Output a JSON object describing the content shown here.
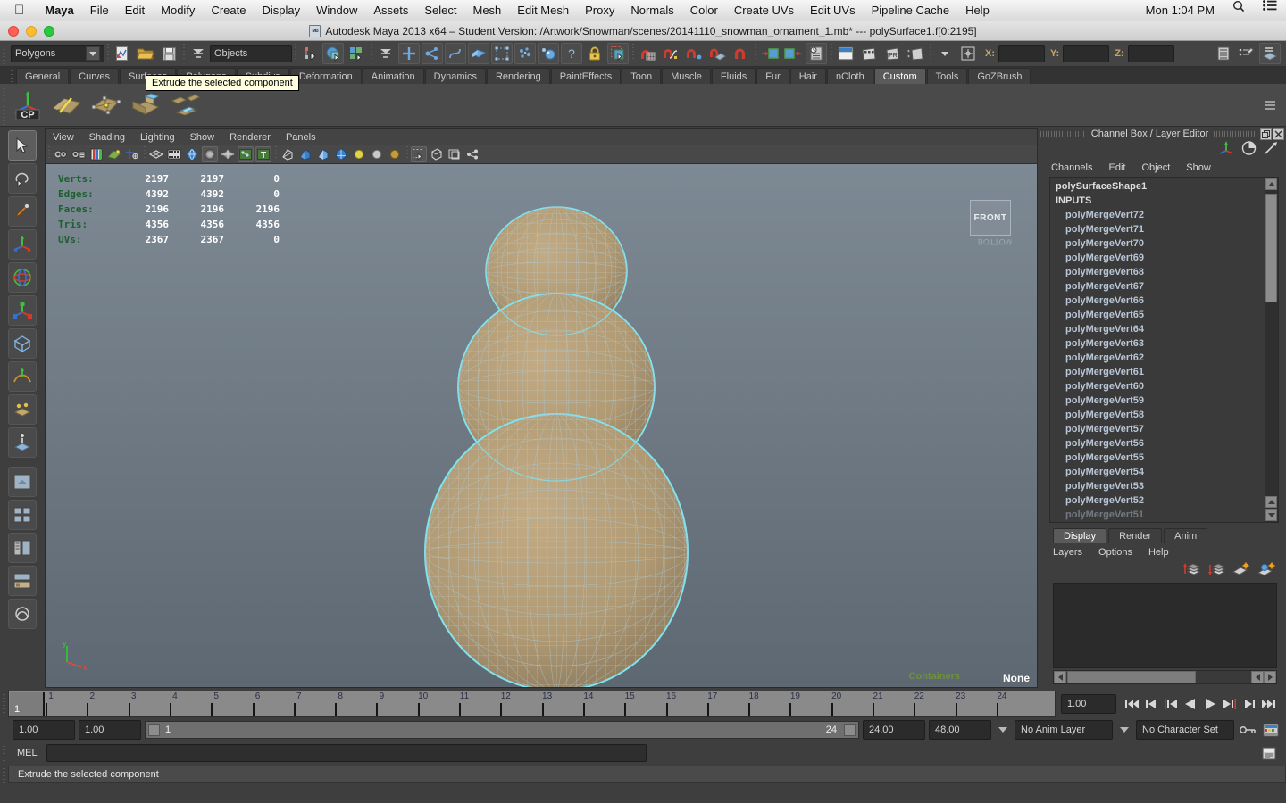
{
  "os_menubar": {
    "apple_icon": "apple-logo-icon",
    "items": [
      "Maya",
      "File",
      "Edit",
      "Modify",
      "Create",
      "Display",
      "Window",
      "Assets",
      "Select",
      "Mesh",
      "Edit Mesh",
      "Proxy",
      "Normals",
      "Color",
      "Create UVs",
      "Edit UVs",
      "Pipeline Cache",
      "Help"
    ],
    "clock": "Mon 1:04 PM",
    "search_icon": "search-icon",
    "list_icon": "list-icon"
  },
  "window": {
    "title": "Autodesk Maya 2013 x64 – Student Version: /Artwork/Snowman/scenes/20141110_snowman_ornament_1.mb*  ---  polySurface1.f[0:2195]",
    "file_badge": "MB"
  },
  "status_line": {
    "menu_set": "Polygons",
    "selection_mask": "Objects",
    "coord_labels": {
      "x": "X:",
      "y": "Y:",
      "z": "Z:"
    },
    "coord_values": {
      "x": "",
      "y": "",
      "z": ""
    },
    "icons": [
      "new-scene-icon",
      "open-scene-icon",
      "save-scene-icon",
      "select-by-hierarchy-icon",
      "select-by-object-type-icon",
      "select-by-component-type-icon",
      "mask-handle-icon",
      "mask-joint-icon",
      "mask-curve-icon",
      "mask-surface-icon",
      "mask-deformation-icon",
      "mask-dynamics-icon",
      "mask-rendering-icon",
      "mask-misc-icon",
      "lock-icon",
      "highlight-selection-icon",
      "snap-to-grid-icon",
      "snap-to-curve-icon",
      "snap-to-point-icon",
      "snap-to-projected-center-icon",
      "snap-to-view-plane-icon",
      "make-live-icon",
      "input-connections-icon",
      "output-connections-icon",
      "construction-history-icon",
      "render-view-icon",
      "render-current-frame-icon",
      "ipr-render-icon",
      "render-settings-icon",
      "open-attribute-editor-icon",
      "open-tool-settings-icon",
      "open-channel-box-icon"
    ]
  },
  "shelf": {
    "tabs": [
      "General",
      "Curves",
      "Surfaces",
      "Polygons",
      "Subdivs",
      "Deformation",
      "Animation",
      "Dynamics",
      "Rendering",
      "PaintEffects",
      "Toon",
      "Muscle",
      "Fluids",
      "Fur",
      "Hair",
      "nCloth",
      "Custom",
      "Tools",
      "GoZBrush"
    ],
    "active_tab": "Custom",
    "buttons": [
      "cp-pivot-icon",
      "insert-edge-loop-icon",
      "multi-cut-icon",
      "extrude-icon",
      "bridge-icon"
    ],
    "tooltip": "Extrude the selected component"
  },
  "toolbox": {
    "tools": [
      "select-tool",
      "lasso-tool",
      "paint-select-tool",
      "move-tool",
      "rotate-tool",
      "scale-tool",
      "universal-manipulator-tool",
      "soft-modification-tool",
      "last-tool-used",
      "show-manipulator-tool",
      "single-perspective-layout",
      "four-view-layout",
      "outliner-persp-layout",
      "hypergraph-persp-layout",
      "persp-graph-layout"
    ]
  },
  "viewport": {
    "menus": [
      "View",
      "Shading",
      "Lighting",
      "Show",
      "Renderer",
      "Panels"
    ],
    "toolbar_icons": [
      "select-camera-icon",
      "lock-camera-icon",
      "bookmarks-icon",
      "image-plane-icon",
      "two-d-pan-zoom-icon",
      "grid-toggle-icon",
      "film-gate-icon",
      "resolution-gate-icon",
      "gate-mask-icon",
      "xray-icon",
      "xray-joints-icon",
      "texture-toggle-icon",
      "wireframe-shading-icon",
      "smooth-shading-icon",
      "smooth-shading-texture-icon",
      "wireframe-on-shaded-icon",
      "default-light-icon",
      "all-lights-icon",
      "shadows-icon",
      "isolate-select-icon",
      "backface-cull-icon",
      "smooth-preview-icon",
      "xray-active-icon"
    ],
    "hud": {
      "rows": [
        {
          "label": "Verts:",
          "c1": "2197",
          "c2": "2197",
          "c3": "0"
        },
        {
          "label": "Edges:",
          "c1": "4392",
          "c2": "4392",
          "c3": "0"
        },
        {
          "label": "Faces:",
          "c1": "2196",
          "c2": "2196",
          "c3": "2196"
        },
        {
          "label": "Tris:",
          "c1": "4356",
          "c2": "4356",
          "c3": "4356"
        },
        {
          "label": "UVs:",
          "c1": "2367",
          "c2": "2367",
          "c3": "0"
        }
      ]
    },
    "view_cube": {
      "front_label": "FRONT",
      "bottom_label": "BOTTOM"
    },
    "containers_label": "Containers",
    "selection_label": "None",
    "axis_gizmo": {
      "y": "y",
      "x": "x"
    },
    "model": "snowman-wireframe-mesh",
    "wire_color": "#7fe3f0"
  },
  "channel_box": {
    "panel_title": "Channel Box / Layer Editor",
    "header_icons": [
      "channel-box-icon",
      "attribute-editor-icon",
      "tool-settings-icon"
    ],
    "window_buttons": [
      "restore-icon",
      "close-icon"
    ],
    "menus": [
      "Channels",
      "Edit",
      "Object",
      "Show"
    ],
    "shape_name": "polySurfaceShape1",
    "inputs_label": "INPUTS",
    "inputs": [
      "polyMergeVert72",
      "polyMergeVert71",
      "polyMergeVert70",
      "polyMergeVert69",
      "polyMergeVert68",
      "polyMergeVert67",
      "polyMergeVert66",
      "polyMergeVert65",
      "polyMergeVert64",
      "polyMergeVert63",
      "polyMergeVert62",
      "polyMergeVert61",
      "polyMergeVert60",
      "polyMergeVert59",
      "polyMergeVert58",
      "polyMergeVert57",
      "polyMergeVert56",
      "polyMergeVert55",
      "polyMergeVert54",
      "polyMergeVert53",
      "polyMergeVert52",
      "polyMergeVert51"
    ]
  },
  "layer_editor": {
    "tabs": [
      "Display",
      "Render",
      "Anim"
    ],
    "active_tab": "Display",
    "menus": [
      "Layers",
      "Options",
      "Help"
    ],
    "icons": [
      "move-layer-up-icon",
      "move-layer-down-icon",
      "new-layer-icon",
      "new-layer-from-selected-icon"
    ],
    "layers": []
  },
  "time_slider": {
    "tick_labels": [
      "1",
      "2",
      "3",
      "4",
      "5",
      "6",
      "7",
      "8",
      "9",
      "10",
      "11",
      "12",
      "13",
      "14",
      "15",
      "16",
      "17",
      "18",
      "19",
      "20",
      "21",
      "22",
      "23",
      "24"
    ],
    "current_frame_marker": "1",
    "current_frame_field": "1.00",
    "playback_buttons": [
      "go-to-start-icon",
      "step-back-keyframe-icon",
      "step-back-frame-icon",
      "play-backwards-icon",
      "play-forwards-icon",
      "step-forward-frame-icon",
      "step-forward-keyframe-icon",
      "go-to-end-icon"
    ]
  },
  "range_slider": {
    "anim_start": "1.00",
    "range_start": "1.00",
    "slider_min_label": "1",
    "slider_max_label": "24",
    "range_end": "24.00",
    "anim_end": "48.00",
    "anim_layer": "No Anim Layer",
    "character_set": "No Character Set",
    "auto_key_icon": "auto-key-icon",
    "anim_prefs_icon": "animation-preferences-icon"
  },
  "command_line": {
    "language_label": "MEL",
    "input_value": "",
    "script_editor_icon": "script-editor-icon"
  },
  "help_line": {
    "text": "Extrude the selected component"
  },
  "colors": {
    "viewport_top": "#7f8b96",
    "viewport_bottom": "#5d6872",
    "wireframe": "#7fe3f0",
    "mesh_fill": "#b09a74",
    "hud_label": "#1d5f2f",
    "ui_bg": "#3e3e3e"
  }
}
